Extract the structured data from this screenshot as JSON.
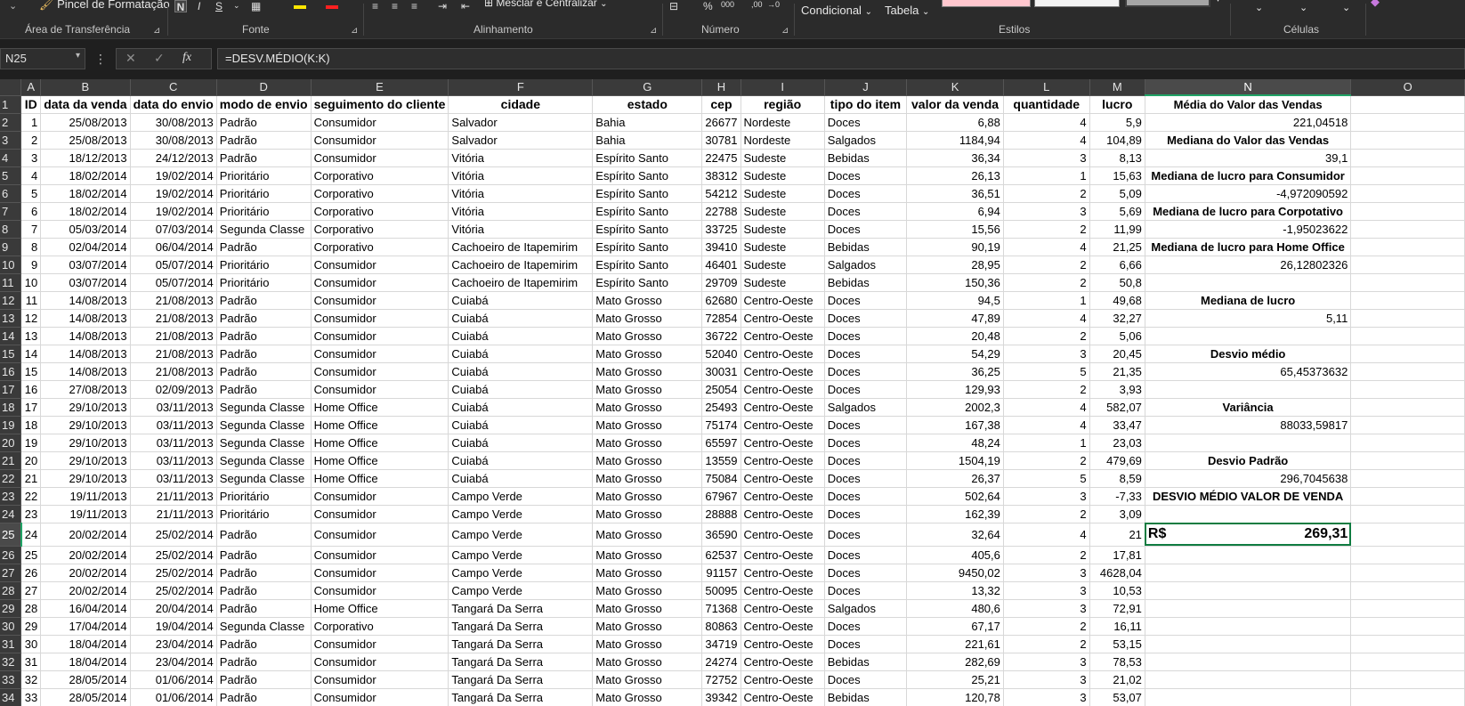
{
  "ribbon": {
    "format_painter": "Pincel de Formatação",
    "merge_center": "Mesclar e Centralizar",
    "conditional": "Condicional",
    "table": "Tabela",
    "groups": {
      "clipboard": "Área de Transferência",
      "font": "Fonte",
      "alignment": "Alinhamento",
      "number": "Número",
      "styles": "Estilos",
      "cells": "Células"
    }
  },
  "formula_bar": {
    "name_box": "N25",
    "formula": "=DESV.MÉDIO(K:K)"
  },
  "columns": [
    "A",
    "B",
    "C",
    "D",
    "E",
    "F",
    "G",
    "H",
    "I",
    "J",
    "K",
    "L",
    "M",
    "N",
    "O"
  ],
  "headers": [
    "ID",
    "data da venda",
    "data do envio",
    "modo de envio",
    "seguimento do cliente",
    "cidade",
    "estado",
    "cep",
    "região",
    "tipo do item",
    "valor da venda",
    "quantidade",
    "lucro"
  ],
  "rows": [
    [
      "1",
      "25/08/2013",
      "30/08/2013",
      "Padrão",
      "Consumidor",
      "Salvador",
      "Bahia",
      "26677",
      "Nordeste",
      "Doces",
      "6,88",
      "4",
      "5,9"
    ],
    [
      "2",
      "25/08/2013",
      "30/08/2013",
      "Padrão",
      "Consumidor",
      "Salvador",
      "Bahia",
      "30781",
      "Nordeste",
      "Salgados",
      "1184,94",
      "4",
      "104,89"
    ],
    [
      "3",
      "18/12/2013",
      "24/12/2013",
      "Padrão",
      "Consumidor",
      "Vitória",
      "Espírito Santo",
      "22475",
      "Sudeste",
      "Bebidas",
      "36,34",
      "3",
      "8,13"
    ],
    [
      "4",
      "18/02/2014",
      "19/02/2014",
      "Prioritário",
      "Corporativo",
      "Vitória",
      "Espírito Santo",
      "38312",
      "Sudeste",
      "Doces",
      "26,13",
      "1",
      "15,63"
    ],
    [
      "5",
      "18/02/2014",
      "19/02/2014",
      "Prioritário",
      "Corporativo",
      "Vitória",
      "Espírito Santo",
      "54212",
      "Sudeste",
      "Doces",
      "36,51",
      "2",
      "5,09"
    ],
    [
      "6",
      "18/02/2014",
      "19/02/2014",
      "Prioritário",
      "Corporativo",
      "Vitória",
      "Espírito Santo",
      "22788",
      "Sudeste",
      "Doces",
      "6,94",
      "3",
      "5,69"
    ],
    [
      "7",
      "05/03/2014",
      "07/03/2014",
      "Segunda Classe",
      "Corporativo",
      "Vitória",
      "Espírito Santo",
      "33725",
      "Sudeste",
      "Doces",
      "15,56",
      "2",
      "11,99"
    ],
    [
      "8",
      "02/04/2014",
      "06/04/2014",
      "Padrão",
      "Corporativo",
      "Cachoeiro de Itapemirim",
      "Espírito Santo",
      "39410",
      "Sudeste",
      "Bebidas",
      "90,19",
      "4",
      "21,25"
    ],
    [
      "9",
      "03/07/2014",
      "05/07/2014",
      "Prioritário",
      "Consumidor",
      "Cachoeiro de Itapemirim",
      "Espírito Santo",
      "46401",
      "Sudeste",
      "Salgados",
      "28,95",
      "2",
      "6,66"
    ],
    [
      "10",
      "03/07/2014",
      "05/07/2014",
      "Prioritário",
      "Consumidor",
      "Cachoeiro de Itapemirim",
      "Espírito Santo",
      "29709",
      "Sudeste",
      "Bebidas",
      "150,36",
      "2",
      "50,8"
    ],
    [
      "11",
      "14/08/2013",
      "21/08/2013",
      "Padrão",
      "Consumidor",
      "Cuiabá",
      "Mato Grosso",
      "62680",
      "Centro-Oeste",
      "Doces",
      "94,5",
      "1",
      "49,68"
    ],
    [
      "12",
      "14/08/2013",
      "21/08/2013",
      "Padrão",
      "Consumidor",
      "Cuiabá",
      "Mato Grosso",
      "72854",
      "Centro-Oeste",
      "Doces",
      "47,89",
      "4",
      "32,27"
    ],
    [
      "13",
      "14/08/2013",
      "21/08/2013",
      "Padrão",
      "Consumidor",
      "Cuiabá",
      "Mato Grosso",
      "36722",
      "Centro-Oeste",
      "Doces",
      "20,48",
      "2",
      "5,06"
    ],
    [
      "14",
      "14/08/2013",
      "21/08/2013",
      "Padrão",
      "Consumidor",
      "Cuiabá",
      "Mato Grosso",
      "52040",
      "Centro-Oeste",
      "Doces",
      "54,29",
      "3",
      "20,45"
    ],
    [
      "15",
      "14/08/2013",
      "21/08/2013",
      "Padrão",
      "Consumidor",
      "Cuiabá",
      "Mato Grosso",
      "30031",
      "Centro-Oeste",
      "Doces",
      "36,25",
      "5",
      "21,35"
    ],
    [
      "16",
      "27/08/2013",
      "02/09/2013",
      "Padrão",
      "Consumidor",
      "Cuiabá",
      "Mato Grosso",
      "25054",
      "Centro-Oeste",
      "Doces",
      "129,93",
      "2",
      "3,93"
    ],
    [
      "17",
      "29/10/2013",
      "03/11/2013",
      "Segunda Classe",
      "Home Office",
      "Cuiabá",
      "Mato Grosso",
      "25493",
      "Centro-Oeste",
      "Salgados",
      "2002,3",
      "4",
      "582,07"
    ],
    [
      "18",
      "29/10/2013",
      "03/11/2013",
      "Segunda Classe",
      "Home Office",
      "Cuiabá",
      "Mato Grosso",
      "75174",
      "Centro-Oeste",
      "Doces",
      "167,38",
      "4",
      "33,47"
    ],
    [
      "19",
      "29/10/2013",
      "03/11/2013",
      "Segunda Classe",
      "Home Office",
      "Cuiabá",
      "Mato Grosso",
      "65597",
      "Centro-Oeste",
      "Doces",
      "48,24",
      "1",
      "23,03"
    ],
    [
      "20",
      "29/10/2013",
      "03/11/2013",
      "Segunda Classe",
      "Home Office",
      "Cuiabá",
      "Mato Grosso",
      "13559",
      "Centro-Oeste",
      "Doces",
      "1504,19",
      "2",
      "479,69"
    ],
    [
      "21",
      "29/10/2013",
      "03/11/2013",
      "Segunda Classe",
      "Home Office",
      "Cuiabá",
      "Mato Grosso",
      "75084",
      "Centro-Oeste",
      "Doces",
      "26,37",
      "5",
      "8,59"
    ],
    [
      "22",
      "19/11/2013",
      "21/11/2013",
      "Prioritário",
      "Consumidor",
      "Campo Verde",
      "Mato Grosso",
      "67967",
      "Centro-Oeste",
      "Doces",
      "502,64",
      "3",
      "-7,33"
    ],
    [
      "23",
      "19/11/2013",
      "21/11/2013",
      "Prioritário",
      "Consumidor",
      "Campo Verde",
      "Mato Grosso",
      "28888",
      "Centro-Oeste",
      "Doces",
      "162,39",
      "2",
      "3,09"
    ],
    [
      "24",
      "20/02/2014",
      "25/02/2014",
      "Padrão",
      "Consumidor",
      "Campo Verde",
      "Mato Grosso",
      "36590",
      "Centro-Oeste",
      "Doces",
      "32,64",
      "4",
      "21"
    ],
    [
      "25",
      "20/02/2014",
      "25/02/2014",
      "Padrão",
      "Consumidor",
      "Campo Verde",
      "Mato Grosso",
      "62537",
      "Centro-Oeste",
      "Doces",
      "405,6",
      "2",
      "17,81"
    ],
    [
      "26",
      "20/02/2014",
      "25/02/2014",
      "Padrão",
      "Consumidor",
      "Campo Verde",
      "Mato Grosso",
      "91157",
      "Centro-Oeste",
      "Doces",
      "9450,02",
      "3",
      "4628,04"
    ],
    [
      "27",
      "20/02/2014",
      "25/02/2014",
      "Padrão",
      "Consumidor",
      "Campo Verde",
      "Mato Grosso",
      "50095",
      "Centro-Oeste",
      "Doces",
      "13,32",
      "3",
      "10,53"
    ],
    [
      "28",
      "16/04/2014",
      "20/04/2014",
      "Padrão",
      "Home Office",
      "Tangará Da Serra",
      "Mato Grosso",
      "71368",
      "Centro-Oeste",
      "Salgados",
      "480,6",
      "3",
      "72,91"
    ],
    [
      "29",
      "17/04/2014",
      "19/04/2014",
      "Segunda Classe",
      "Corporativo",
      "Tangará Da Serra",
      "Mato Grosso",
      "80863",
      "Centro-Oeste",
      "Doces",
      "67,17",
      "2",
      "16,11"
    ],
    [
      "30",
      "18/04/2014",
      "23/04/2014",
      "Padrão",
      "Consumidor",
      "Tangará Da Serra",
      "Mato Grosso",
      "34719",
      "Centro-Oeste",
      "Doces",
      "221,61",
      "2",
      "53,15"
    ],
    [
      "31",
      "18/04/2014",
      "23/04/2014",
      "Padrão",
      "Consumidor",
      "Tangará Da Serra",
      "Mato Grosso",
      "24274",
      "Centro-Oeste",
      "Bebidas",
      "282,69",
      "3",
      "78,53"
    ],
    [
      "32",
      "28/05/2014",
      "01/06/2014",
      "Padrão",
      "Consumidor",
      "Tangará Da Serra",
      "Mato Grosso",
      "72752",
      "Centro-Oeste",
      "Doces",
      "25,21",
      "3",
      "21,02"
    ],
    [
      "33",
      "28/05/2014",
      "01/06/2014",
      "Padrão",
      "Consumidor",
      "Tangará Da Serra",
      "Mato Grosso",
      "39342",
      "Centro-Oeste",
      "Bebidas",
      "120,78",
      "3",
      "53,07"
    ]
  ],
  "stats": {
    "1": {
      "text": "Média do Valor das Vendas",
      "bold": true
    },
    "2": {
      "text": "221,04518",
      "bold": false
    },
    "3": {
      "text": "Mediana do Valor das Vendas",
      "bold": true
    },
    "4": {
      "text": "39,1",
      "bold": false
    },
    "5": {
      "text": "Mediana de lucro para Consumidor",
      "bold": true
    },
    "6": {
      "text": "-4,972090592",
      "bold": false
    },
    "7": {
      "text": "Mediana de lucro para Corpotativo",
      "bold": true
    },
    "8": {
      "text": "-1,95023622",
      "bold": false
    },
    "9": {
      "text": "Mediana de lucro para Home Office",
      "bold": true
    },
    "10": {
      "text": "26,12802326",
      "bold": false
    },
    "12": {
      "text": "Mediana de lucro",
      "bold": true
    },
    "13": {
      "text": "5,11",
      "bold": false
    },
    "15": {
      "text": "Desvio médio",
      "bold": true
    },
    "16": {
      "text": "65,45373632",
      "bold": false
    },
    "18": {
      "text": "Variância",
      "bold": true
    },
    "19": {
      "text": "88033,59817",
      "bold": false
    },
    "21": {
      "text": "Desvio Padrão",
      "bold": true
    },
    "22": {
      "text": "296,7045638",
      "bold": false
    },
    "23": {
      "text": "DESVIO MÉDIO VALOR DE VENDA",
      "bold": true
    }
  },
  "highlight": {
    "currency": "R$",
    "value": "269,31"
  }
}
